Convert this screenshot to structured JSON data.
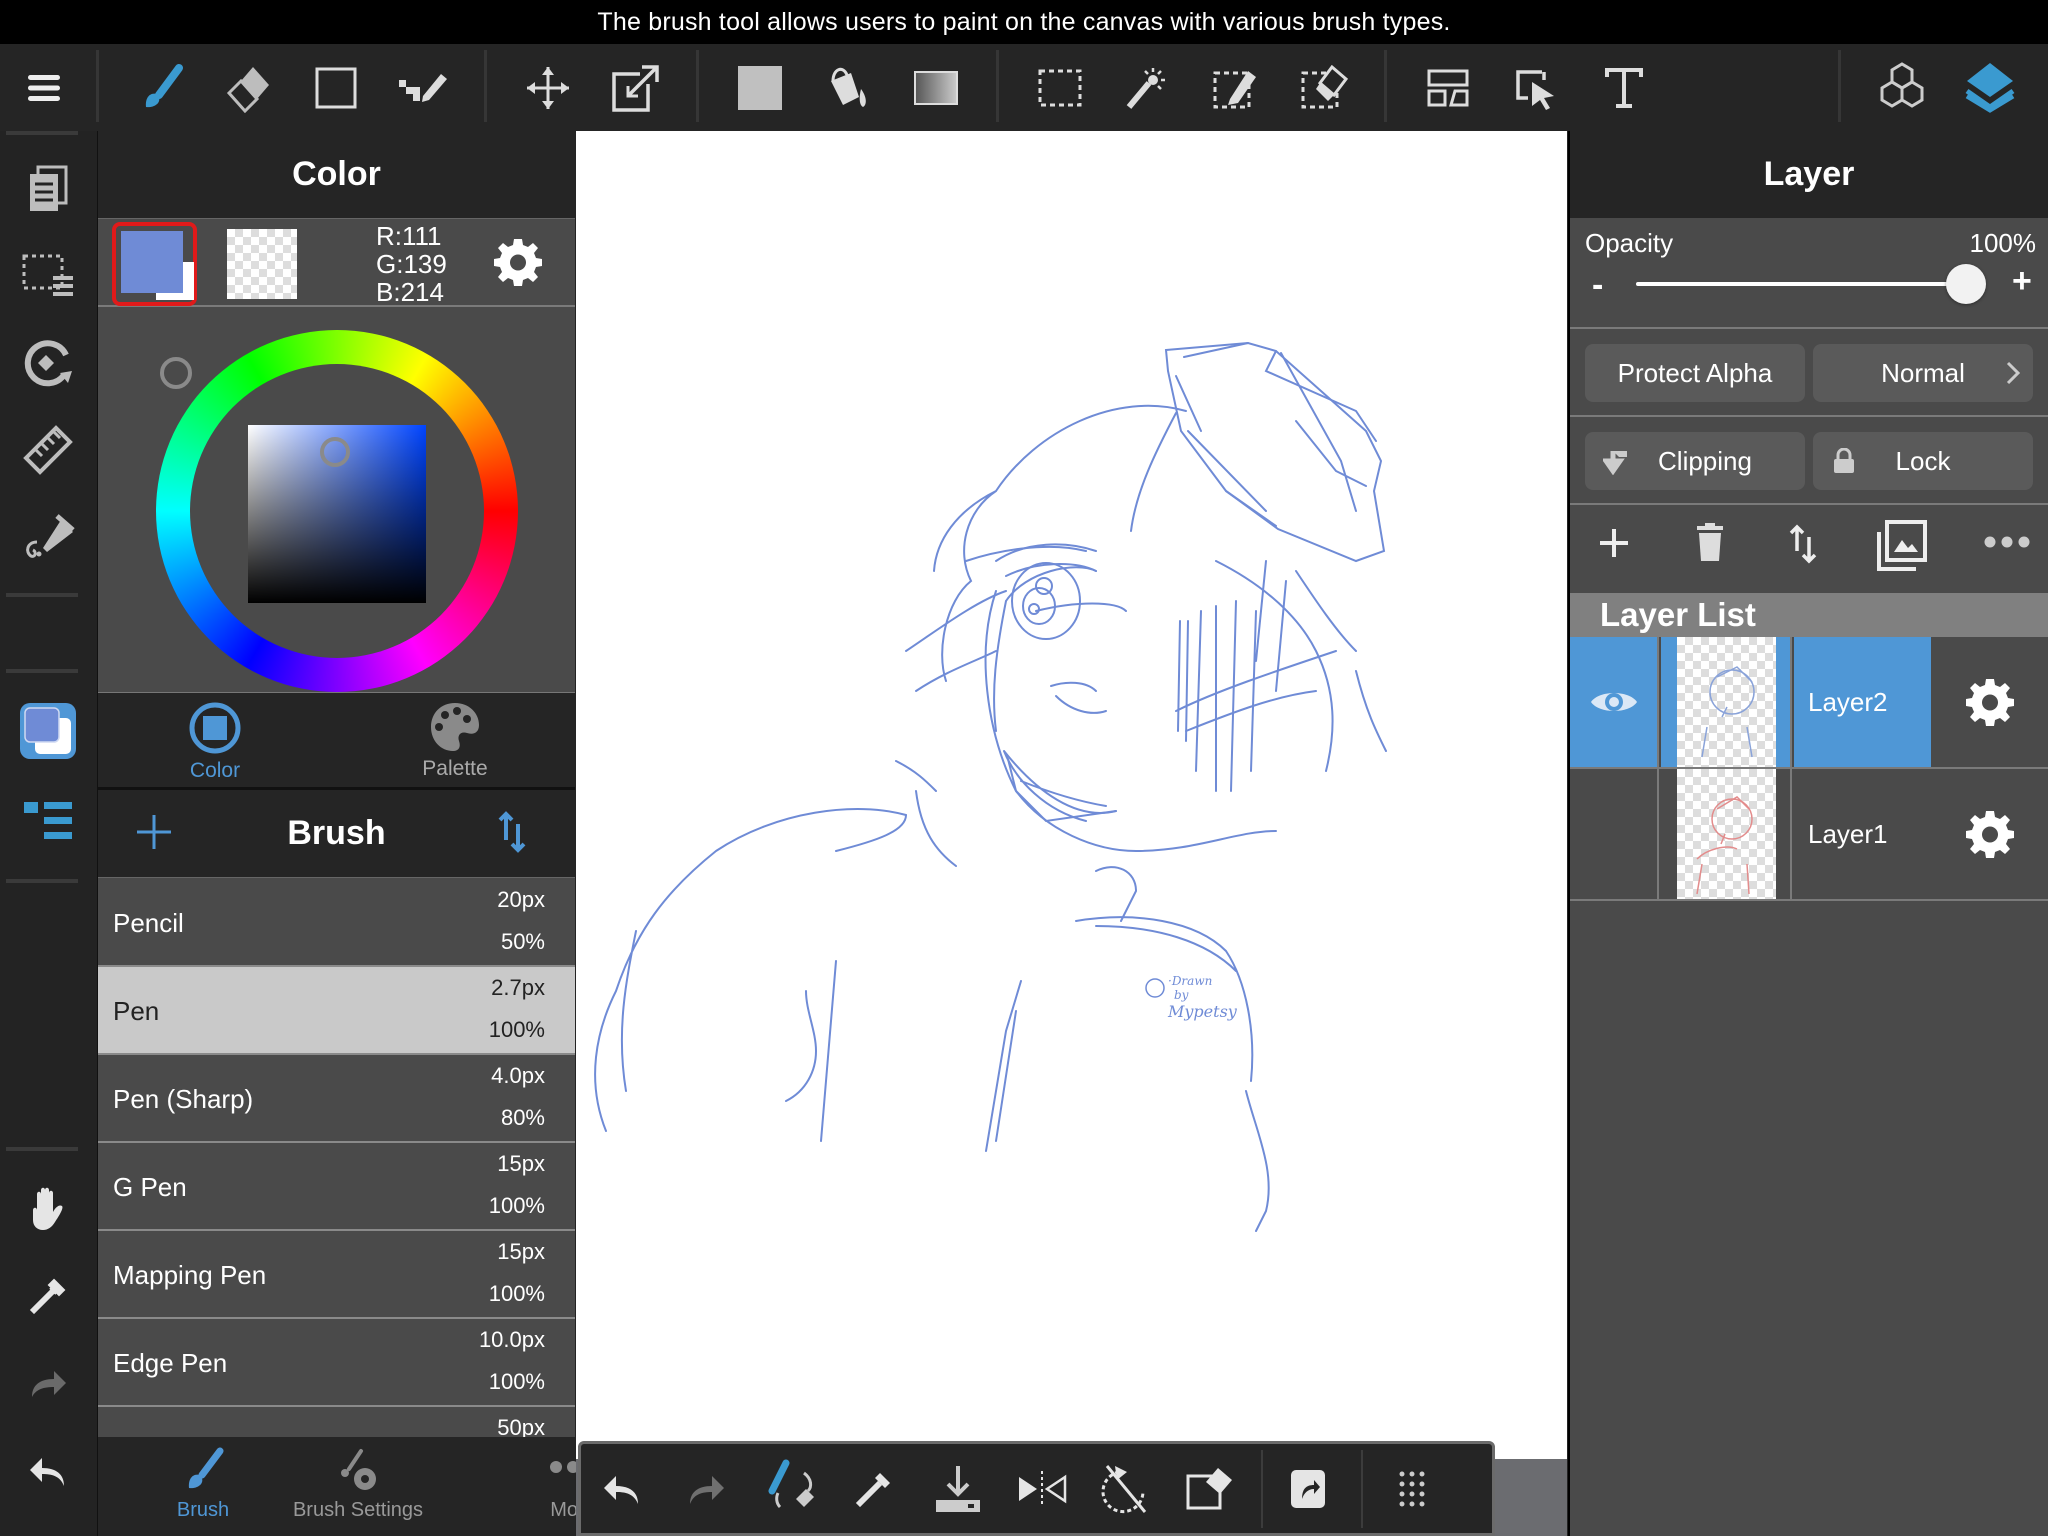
{
  "title_bar": {
    "text": "The brush tool allows users to paint on the canvas with various brush types."
  },
  "colors": {
    "accent": "#4f97d6",
    "icon_active": "#3a9ad0",
    "current_color": "#6f8bd6",
    "stroke": "#6f8bd6",
    "selection_red": "#e01a1a"
  },
  "toolbar": {
    "items": [
      {
        "icon": "menu-icon",
        "label": "Menu"
      },
      {
        "icon": "brush-icon",
        "label": "Brush",
        "active": true
      },
      {
        "icon": "eraser-icon",
        "label": "Eraser"
      },
      {
        "icon": "shape-rectangle-icon",
        "label": "Shape"
      },
      {
        "icon": "dot-pen-icon",
        "label": "Dot Pen"
      },
      {
        "icon": "move-icon",
        "label": "Move"
      },
      {
        "icon": "transform-icon",
        "label": "Transform"
      },
      {
        "icon": "fill-rectangle-icon",
        "label": "Fill"
      },
      {
        "icon": "bucket-icon",
        "label": "Bucket"
      },
      {
        "icon": "gradient-icon",
        "label": "Gradient"
      },
      {
        "icon": "select-icon",
        "label": "Select"
      },
      {
        "icon": "magic-wand-icon",
        "label": "Magic Wand"
      },
      {
        "icon": "select-pen-icon",
        "label": "Select Pen"
      },
      {
        "icon": "select-eraser-icon",
        "label": "Select Eraser"
      },
      {
        "icon": "frame-divider-icon",
        "label": "Frame Divider"
      },
      {
        "icon": "operation-icon",
        "label": "Operation"
      },
      {
        "icon": "text-icon",
        "label": "Text"
      },
      {
        "icon": "materials-icon",
        "label": "Materials"
      },
      {
        "icon": "layers-icon",
        "label": "Layers",
        "active": true
      }
    ]
  },
  "sidebar": {
    "items": [
      {
        "icon": "copy-icon",
        "label": "Copy Layer"
      },
      {
        "icon": "selection-list-icon",
        "label": "Selection"
      },
      {
        "icon": "rotate-icon",
        "label": "Rotate"
      },
      {
        "icon": "ruler-icon",
        "label": "Ruler"
      },
      {
        "icon": "snap-icon",
        "label": "Snap"
      },
      {
        "icon": "color-window-icon",
        "label": "Color Window",
        "active": true
      },
      {
        "icon": "brush-list-icon",
        "label": "Brush List",
        "active": true
      },
      {
        "icon": "hand-icon",
        "label": "Hand"
      },
      {
        "icon": "eyedropper-icon",
        "label": "Eyedropper"
      },
      {
        "icon": "redo-icon",
        "label": "Redo"
      },
      {
        "icon": "undo-icon",
        "label": "Undo"
      }
    ]
  },
  "color_panel": {
    "title": "Color",
    "rgb": {
      "r": "R:111",
      "g": "G:139",
      "b": "B:214"
    },
    "hue_degrees": 224,
    "saturation": 0.48,
    "brightness": 0.84,
    "tabs": [
      {
        "label": "Color",
        "active": true
      },
      {
        "label": "Palette",
        "active": false
      }
    ]
  },
  "brush_panel": {
    "title": "Brush",
    "items": [
      {
        "name": "Pencil",
        "size": "20px",
        "opacity": "50%"
      },
      {
        "name": "Pen",
        "size": "2.7px",
        "opacity": "100%",
        "selected": true
      },
      {
        "name": "Pen (Sharp)",
        "size": "4.0px",
        "opacity": "80%"
      },
      {
        "name": "G Pen",
        "size": "15px",
        "opacity": "100%"
      },
      {
        "name": "Mapping Pen",
        "size": "15px",
        "opacity": "100%"
      },
      {
        "name": "Edge Pen",
        "size": "10.0px",
        "opacity": "100%"
      },
      {
        "name": "",
        "size": "50px",
        "opacity": ""
      }
    ],
    "tabs": [
      {
        "label": "Brush",
        "active": true
      },
      {
        "label": "Brush Settings",
        "active": false
      },
      {
        "label": "More",
        "active": false
      }
    ]
  },
  "canvas": {
    "signature_lines": [
      "·Drawn",
      "by",
      "Mypetsy"
    ]
  },
  "bottom_toolbar": {
    "items": [
      {
        "icon": "undo-icon",
        "label": "Undo"
      },
      {
        "icon": "redo-icon",
        "label": "Redo"
      },
      {
        "icon": "brush-eraser-toggle-icon",
        "label": "Brush/Eraser toggle"
      },
      {
        "icon": "eyedropper-icon",
        "label": "Eyedropper"
      },
      {
        "icon": "save-icon",
        "label": "Save"
      },
      {
        "icon": "flip-icon",
        "label": "Flip"
      },
      {
        "icon": "reset-rotation-icon",
        "label": "Reset Rotation"
      },
      {
        "icon": "clear-icon",
        "label": "Clear"
      },
      {
        "icon": "share-icon",
        "label": "Share"
      },
      {
        "icon": "grid-menu-icon",
        "label": "More"
      }
    ]
  },
  "layer_panel": {
    "title": "Layer",
    "opacity_label": "Opacity",
    "opacity_value": "100%",
    "opacity_fraction": 1.0,
    "minus_label": "-",
    "plus_label": "+",
    "protect_alpha_label": "Protect Alpha",
    "blend_mode_label": "Normal",
    "clipping_label": "Clipping",
    "lock_label": "Lock",
    "list_title": "Layer List",
    "layers": [
      {
        "name": "Layer2",
        "visible": true,
        "selected": true,
        "thumb_color": "#8aa3d9"
      },
      {
        "name": "Layer1",
        "visible": false,
        "selected": false,
        "thumb_color": "#e38c8c"
      }
    ]
  }
}
